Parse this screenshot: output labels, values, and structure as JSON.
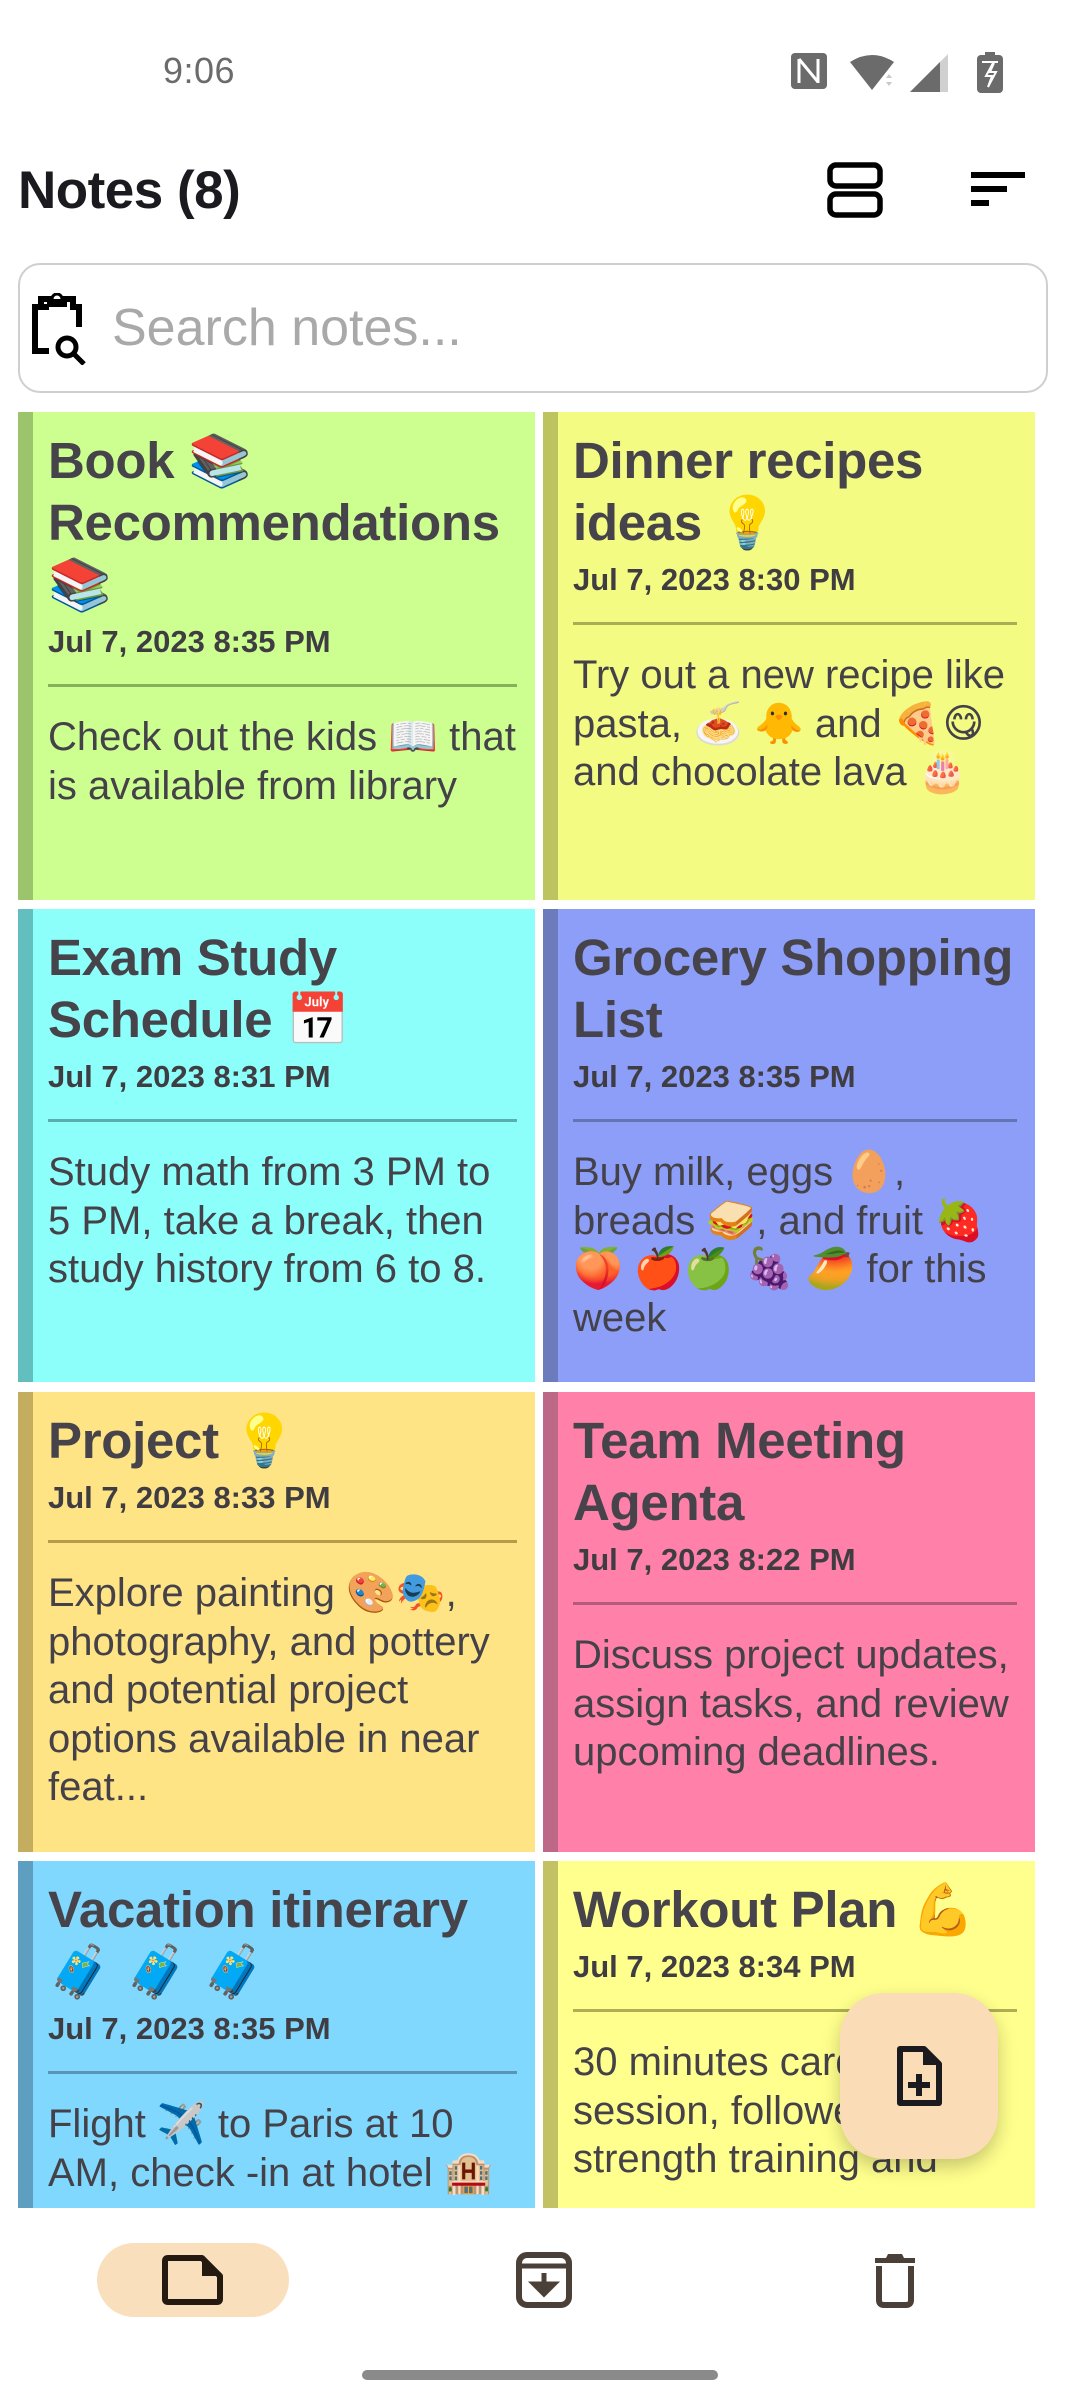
{
  "status_bar": {
    "time": "9:06",
    "icons": [
      "nfc-icon",
      "wifi-icon",
      "cell-signal-icon",
      "battery-charging-icon"
    ]
  },
  "header": {
    "title": "Notes (8)",
    "layout_toggle_icon": "view-agenda-icon",
    "sort_icon": "sort-icon"
  },
  "search": {
    "placeholder": "Search notes...",
    "value": "",
    "icon": "clipboard-search-icon"
  },
  "notes": [
    {
      "title": "Book 📚 Recommendations 📚",
      "date": "Jul 7, 2023 8:35 PM",
      "body": "Check out the kids 📖 that is available from library",
      "color": "#ccff90",
      "bar_color": "#9bc46d",
      "divider_color": "#86b05a"
    },
    {
      "title": "Dinner recipes ideas 💡",
      "date": "Jul 7, 2023 8:30 PM",
      "body": "Try out a new recipe like pasta, 🍝 🐥 and 🍕😋 and chocolate lava 🎂",
      "color": "#f3fb83",
      "bar_color": "#bcc35f",
      "divider_color": "#a9ae55"
    },
    {
      "title": "Exam Study Schedule 📅",
      "date": "Jul 7, 2023 8:31 PM",
      "body": "Study math from 3 PM to 5 PM, take a break, then study history from 6 to 8.",
      "color": "#8cfffb",
      "bar_color": "#63bfbf",
      "divider_color": "#5aaeb0"
    },
    {
      "title": "Grocery Shopping List",
      "date": "Jul 7, 2023 8:35 PM",
      "body": "Buy milk, eggs 🥚, breads 🥪, and fruit 🍓 🍑 🍎🍏 🍇 🥭 for this week",
      "color": "#8c9ef8",
      "bar_color": "#6b7bbb",
      "divider_color": "#6475b5"
    },
    {
      "title": "Project 💡",
      "date": "Jul 7, 2023 8:33 PM",
      "body": "Explore painting 🎨🎭, photography, and pottery and potential project options available in near feat...",
      "color": "#ffe486",
      "bar_color": "#c4ad5f",
      "divider_color": "#b59c4c"
    },
    {
      "title": "Team Meeting Agenta",
      "date": "Jul 7, 2023 8:22 PM",
      "body": "Discuss project updates, assign tasks, and review upcoming deadlines.",
      "color": "#ff80a8",
      "bar_color": "#bd6886",
      "divider_color": "#b25c7b"
    },
    {
      "title": "Vacation itinerary 🧳 🧳 🧳",
      "date": "Jul 7, 2023 8:35 PM",
      "body": "Flight ✈️ to Paris at 10 AM, check -in at hotel 🏨",
      "color": "#80d8ff",
      "bar_color": "#5e9ec0",
      "divider_color": "#5a95b5"
    },
    {
      "title": "Workout Plan 💪",
      "date": "Jul 7, 2023 8:34 PM",
      "body": "30 minutes cardio session, followed by strength training and",
      "color": "#ffff8d",
      "bar_color": "#c2c163",
      "divider_color": "#aeae55"
    }
  ],
  "fab": {
    "icon": "note-add-icon",
    "label": "New note"
  },
  "bottom_nav": {
    "items": [
      {
        "id": "notes",
        "icon": "note-icon",
        "active": true
      },
      {
        "id": "archive",
        "icon": "archive-icon",
        "active": false
      },
      {
        "id": "trash",
        "icon": "trash-icon",
        "active": false
      }
    ],
    "active_color": "#fadfbd"
  }
}
